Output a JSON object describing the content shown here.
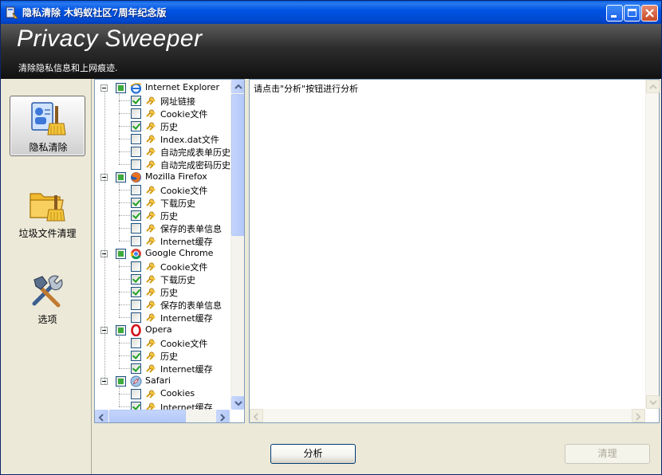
{
  "window": {
    "title": "隐私清除  木蚂蚁社区7周年纪念版",
    "controls": [
      "minimize-icon",
      "maximize-icon",
      "close-icon"
    ]
  },
  "banner": {
    "product": "Privacy Sweeper",
    "subtitle": "清除隐私信息和上网痕迹."
  },
  "nav": [
    {
      "label": "隐私清除",
      "icon": "privacy-sweep-icon",
      "active": true
    },
    {
      "label": "垃圾文件清理",
      "icon": "junk-folder-icon",
      "active": false
    },
    {
      "label": "选项",
      "icon": "tools-icon",
      "active": false
    }
  ],
  "tree": {
    "browsers": [
      {
        "name": "Internet Explorer",
        "icon": "ie-icon",
        "state": "partial",
        "items": [
          {
            "label": "网址链接",
            "checked": true
          },
          {
            "label": "Cookie文件",
            "checked": false
          },
          {
            "label": "历史",
            "checked": true
          },
          {
            "label": "Index.dat文件",
            "checked": false
          },
          {
            "label": "自动完成表单历史",
            "checked": false
          },
          {
            "label": "自动完成密码历史",
            "checked": false
          }
        ]
      },
      {
        "name": "Mozilla Firefox",
        "icon": "firefox-icon",
        "state": "partial",
        "items": [
          {
            "label": "Cookie文件",
            "checked": false
          },
          {
            "label": "下载历史",
            "checked": true
          },
          {
            "label": "历史",
            "checked": true
          },
          {
            "label": "保存的表单信息",
            "checked": false
          },
          {
            "label": "Internet缓存",
            "checked": false
          }
        ]
      },
      {
        "name": "Google Chrome",
        "icon": "chrome-icon",
        "state": "partial",
        "items": [
          {
            "label": "Cookie文件",
            "checked": false
          },
          {
            "label": "下载历史",
            "checked": true
          },
          {
            "label": "历史",
            "checked": true
          },
          {
            "label": "保存的表单信息",
            "checked": false
          },
          {
            "label": "Internet缓存",
            "checked": false
          }
        ]
      },
      {
        "name": "Opera",
        "icon": "opera-icon",
        "state": "partial",
        "items": [
          {
            "label": "Cookie文件",
            "checked": false
          },
          {
            "label": "历史",
            "checked": true
          },
          {
            "label": "Internet缓存",
            "checked": true
          }
        ]
      },
      {
        "name": "Safari",
        "icon": "safari-icon",
        "state": "partial",
        "items": [
          {
            "label": "Cookies",
            "checked": false
          },
          {
            "label": "Internet缓存",
            "checked": true
          }
        ]
      }
    ]
  },
  "output": {
    "message": "请点击\"分析\"按钮进行分析"
  },
  "buttons": {
    "analyze": "分析",
    "clean": "清理"
  }
}
